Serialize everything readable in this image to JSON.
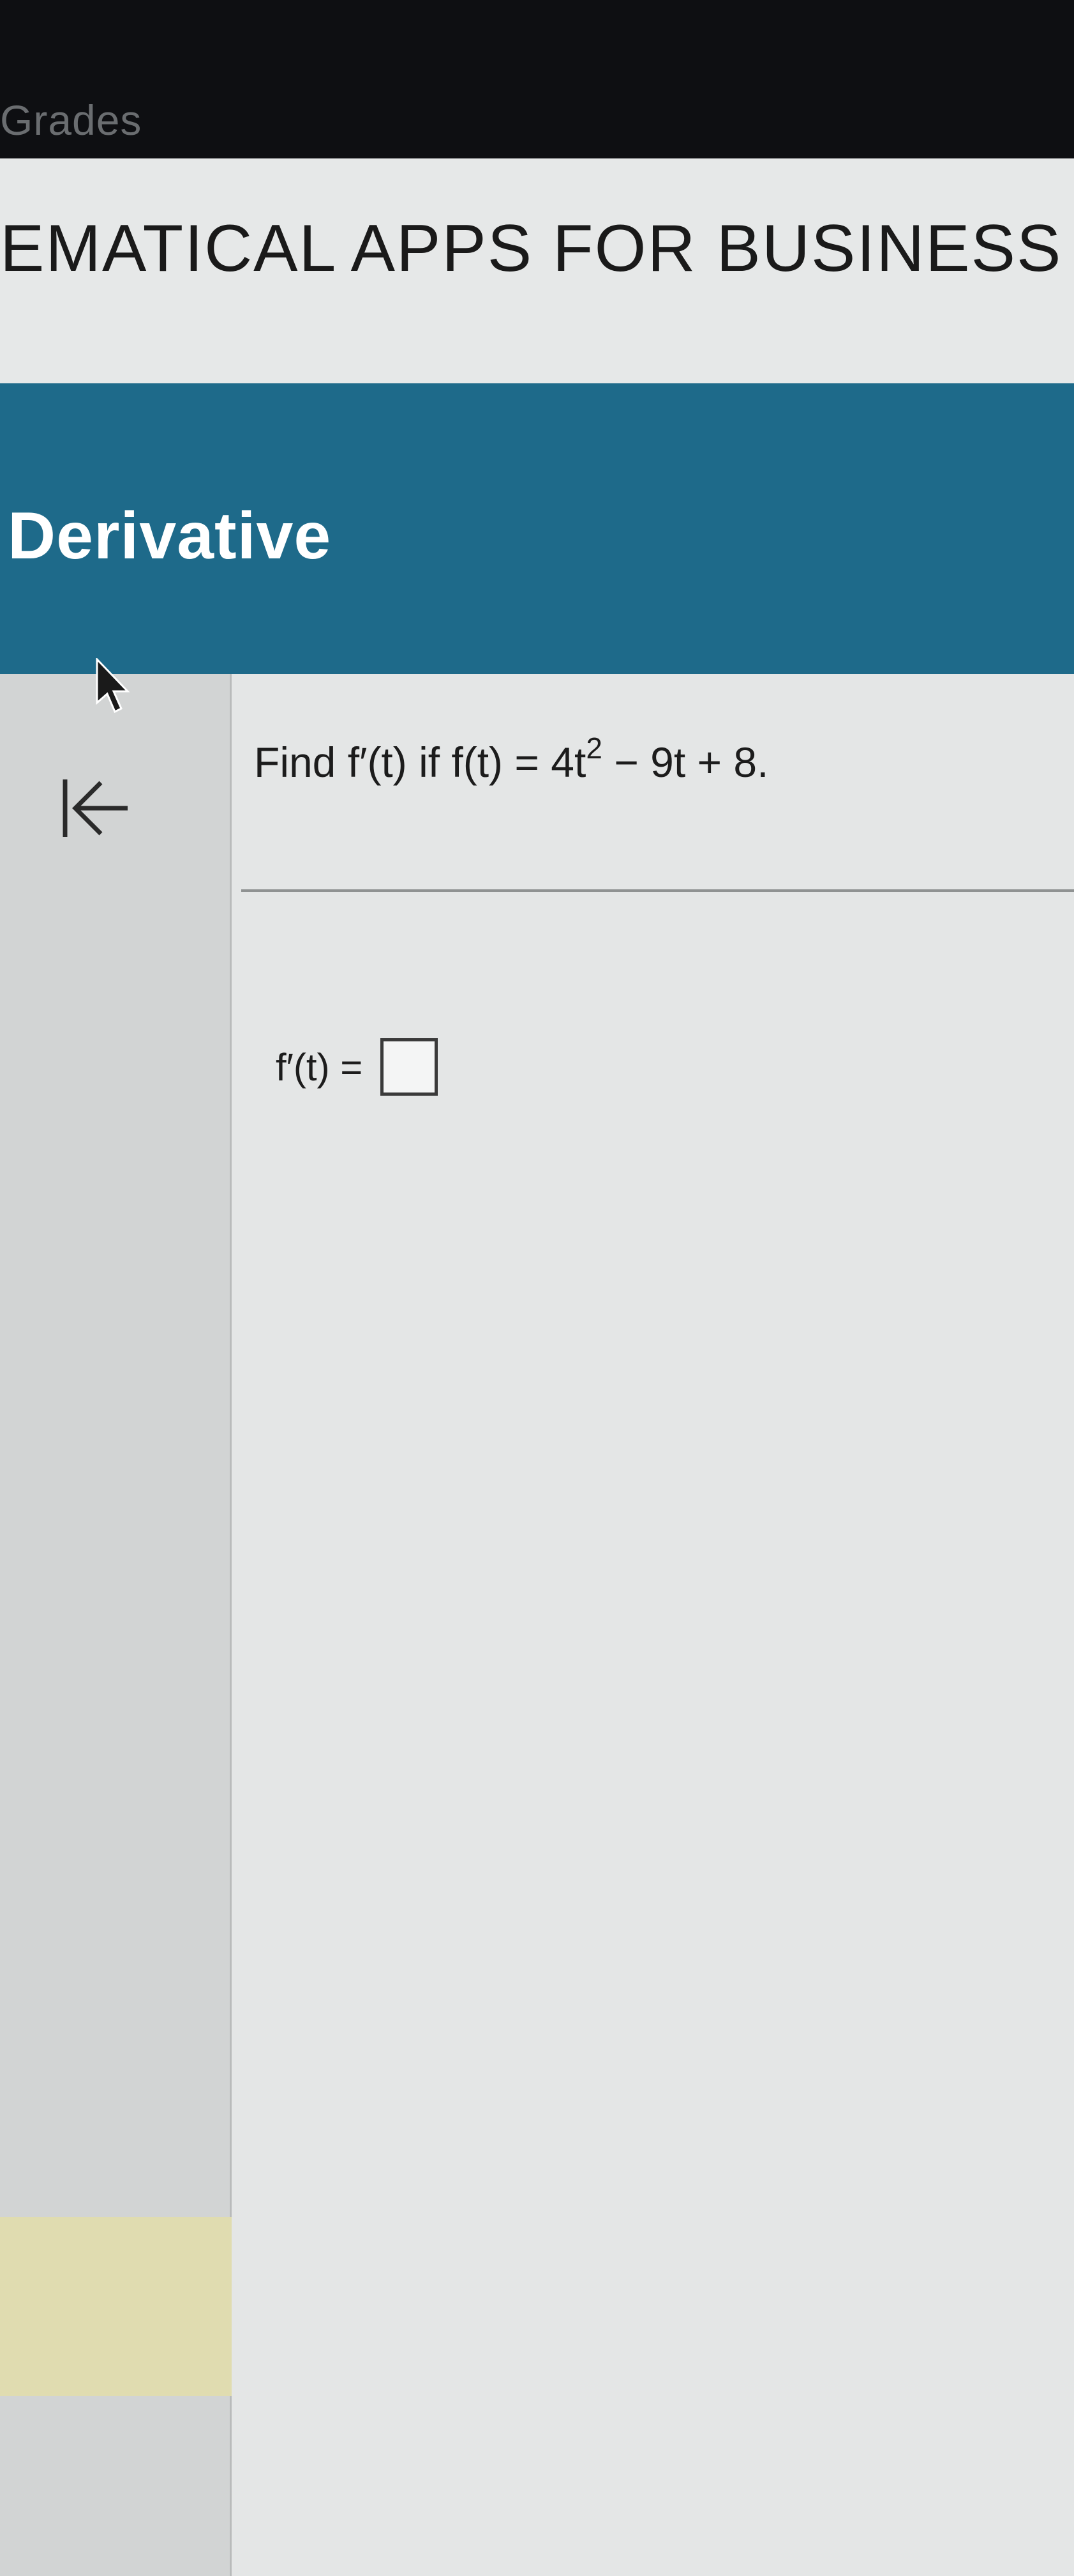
{
  "nav": {
    "grades_label": "Grades"
  },
  "course": {
    "title": "EMATICAL APPS FOR BUSINESS"
  },
  "section": {
    "title": "Derivative"
  },
  "question": {
    "text_before_exp": "Find f′(t) if f(t) = 4t",
    "exponent": "2",
    "text_after_exp": " − 9t + 8."
  },
  "answer": {
    "label": "f′(t) =",
    "value": ""
  },
  "icons": {
    "collapse": "collapse-left-icon",
    "cursor": "mouse-pointer-icon"
  },
  "colors": {
    "banner": "#1e6a8a",
    "topbar": "#0e0f12",
    "highlight": "#e0dcb0"
  }
}
